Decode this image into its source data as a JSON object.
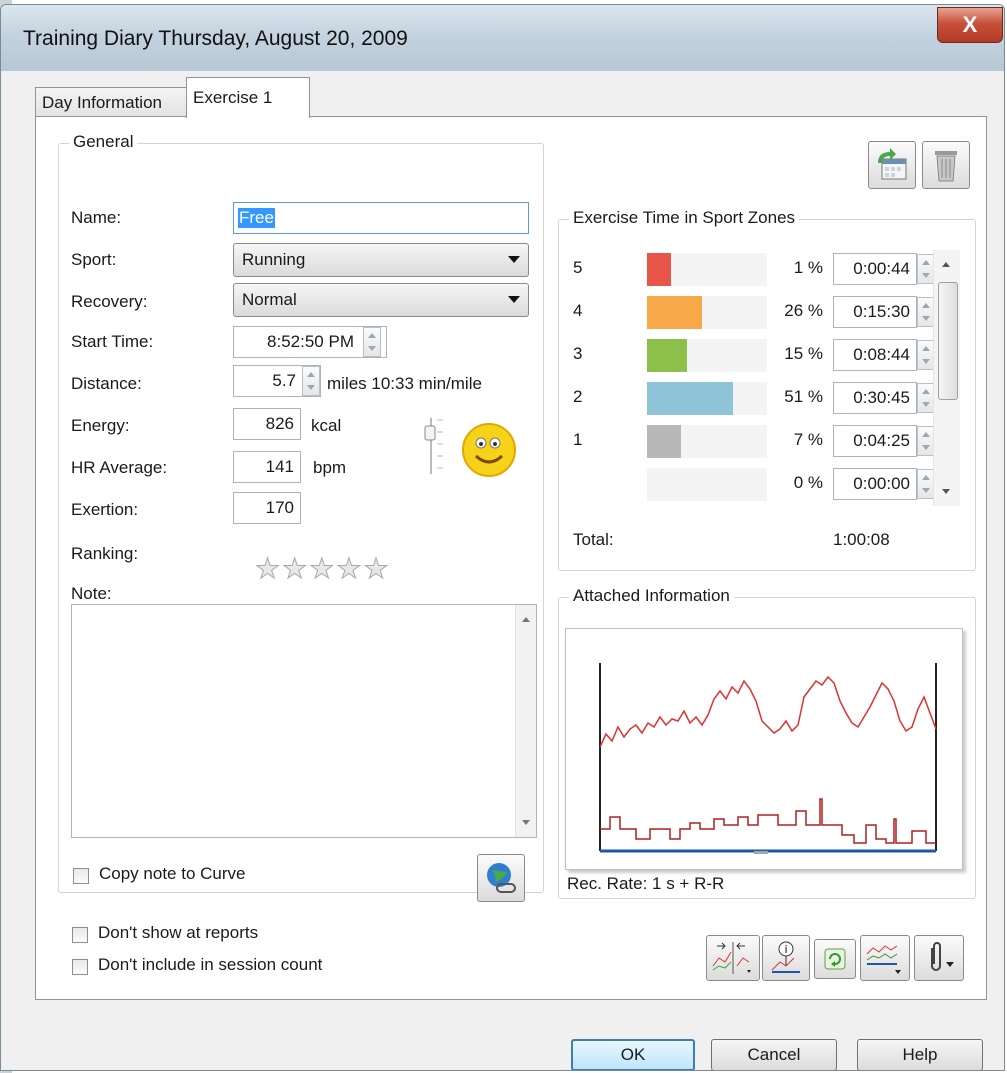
{
  "window": {
    "title": "Training Diary   Thursday, August 20, 2009",
    "close_glyph": "X"
  },
  "tabs": [
    "Day Information",
    "Exercise 1"
  ],
  "general": {
    "group_label": "General",
    "name_label": "Name:",
    "name_value": "Free",
    "sport_label": "Sport:",
    "sport_value": "Running",
    "recovery_label": "Recovery:",
    "recovery_value": "Normal",
    "start_time_label": "Start Time:",
    "start_time_value": "8:52:50 PM",
    "distance_label": "Distance:",
    "distance_value": "5.7",
    "distance_unit": "miles 10:33  min/mile",
    "energy_label": "Energy:",
    "energy_value": "826",
    "energy_unit": "kcal",
    "hr_label": "HR Average:",
    "hr_value": "141",
    "hr_unit": "bpm",
    "exertion_label": "Exertion:",
    "exertion_value": "170",
    "ranking_label": "Ranking:",
    "ranking_stars": 0,
    "ranking_max": 5,
    "note_label": "Note:",
    "note_value": "",
    "copy_note_label": "Copy note to Curve"
  },
  "sport_zones": {
    "group_label": "Exercise Time in Sport Zones",
    "zones": [
      {
        "zone": "5",
        "percent": "1 %",
        "time": "0:00:44",
        "fraction": 0.2,
        "color": "#e8564a"
      },
      {
        "zone": "4",
        "percent": "26 %",
        "time": "0:15:30",
        "fraction": 0.46,
        "color": "#f7a94a"
      },
      {
        "zone": "3",
        "percent": "15 %",
        "time": "0:08:44",
        "fraction": 0.33,
        "color": "#8cc04a"
      },
      {
        "zone": "2",
        "percent": "51 %",
        "time": "0:30:45",
        "fraction": 0.72,
        "color": "#8ec3d8"
      },
      {
        "zone": "1",
        "percent": "7 %",
        "time": "0:04:25",
        "fraction": 0.28,
        "color": "#b8b8b8"
      },
      {
        "zone": "",
        "percent": "0 %",
        "time": "0:00:00",
        "fraction": 0,
        "color": "#b8b8b8"
      }
    ],
    "total_label": "Total:",
    "total_value": "1:00:08"
  },
  "attached": {
    "group_label": "Attached Information",
    "rec_rate": "Rec. Rate: 1 s + R-R"
  },
  "checkboxes": {
    "dont_show": "Don't show at reports",
    "dont_include": "Don't include in session count"
  },
  "buttons": {
    "ok": "OK",
    "cancel": "Cancel",
    "help": "Help"
  },
  "icons": [
    "copy-to-calendar-icon",
    "trash-icon",
    "web-link-icon",
    "compare-icon",
    "info-marker-icon",
    "refresh-icon",
    "curve-menu-icon",
    "attachment-icon"
  ]
}
